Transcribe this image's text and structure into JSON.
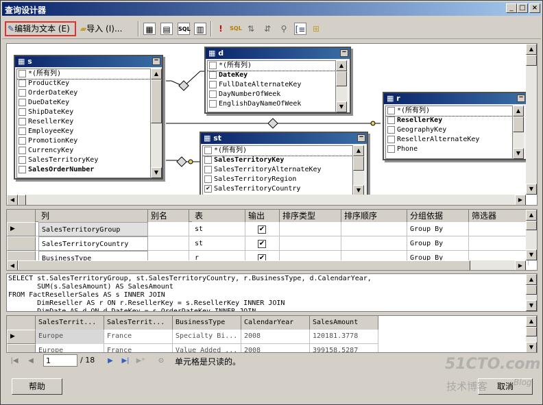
{
  "window": {
    "title": "查询设计器",
    "minimize_label": "_",
    "maximize_label": "□",
    "close_label": "×"
  },
  "toolbar": {
    "edit_as_text": "编辑为文本 (E)",
    "import": "导入 (I)..."
  },
  "diagram": {
    "tables": [
      {
        "name": "s",
        "columns": [
          {
            "label": "*(所有列)",
            "bold": false,
            "checked": false
          },
          {
            "label": "ProductKey",
            "bold": false,
            "checked": false
          },
          {
            "label": "OrderDateKey",
            "bold": false,
            "checked": false
          },
          {
            "label": "DueDateKey",
            "bold": false,
            "checked": false
          },
          {
            "label": "ShipDateKey",
            "bold": false,
            "checked": false
          },
          {
            "label": "ResellerKey",
            "bold": false,
            "checked": false
          },
          {
            "label": "EmployeeKey",
            "bold": false,
            "checked": false
          },
          {
            "label": "PromotionKey",
            "bold": false,
            "checked": false
          },
          {
            "label": "CurrencyKey",
            "bold": false,
            "checked": false
          },
          {
            "label": "SalesTerritoryKey",
            "bold": false,
            "checked": false
          },
          {
            "label": "SalesOrderNumber",
            "bold": true,
            "checked": false
          }
        ]
      },
      {
        "name": "d",
        "columns": [
          {
            "label": "*(所有列)",
            "bold": false,
            "checked": false
          },
          {
            "label": "DateKey",
            "bold": true,
            "checked": false
          },
          {
            "label": "FullDateAlternateKey",
            "bold": false,
            "checked": false
          },
          {
            "label": "DayNumberOfWeek",
            "bold": false,
            "checked": false
          },
          {
            "label": "EnglishDayNameOfWeek",
            "bold": false,
            "checked": false
          }
        ]
      },
      {
        "name": "r",
        "columns": [
          {
            "label": "*(所有列)",
            "bold": false,
            "checked": false
          },
          {
            "label": "ResellerKey",
            "bold": true,
            "checked": false
          },
          {
            "label": "GeographyKey",
            "bold": false,
            "checked": false
          },
          {
            "label": "ResellerAlternateKey",
            "bold": false,
            "checked": false
          },
          {
            "label": "Phone",
            "bold": false,
            "checked": false
          }
        ]
      },
      {
        "name": "st",
        "columns": [
          {
            "label": "*(所有列)",
            "bold": false,
            "checked": false
          },
          {
            "label": "SalesTerritoryKey",
            "bold": true,
            "checked": false
          },
          {
            "label": "SalesTerritoryAlternateKey",
            "bold": false,
            "checked": false
          },
          {
            "label": "SalesTerritoryRegion",
            "bold": false,
            "checked": false
          },
          {
            "label": "SalesTerritoryCountry",
            "bold": false,
            "checked": true
          }
        ]
      }
    ]
  },
  "criteria": {
    "headers": [
      "列",
      "别名",
      "表",
      "输出",
      "排序类型",
      "排序顺序",
      "分组依据",
      "筛选器"
    ],
    "rows": [
      {
        "column": "SalesTerritoryGroup",
        "alias": "",
        "table": "st",
        "output": "✔",
        "group": "Group By"
      },
      {
        "column": "SalesTerritoryCountry",
        "alias": "",
        "table": "st",
        "output": "✔",
        "group": "Group By"
      },
      {
        "column": "BusinessType",
        "alias": "",
        "table": "r",
        "output": "✔",
        "group": "Group By"
      }
    ]
  },
  "sql": {
    "lines": [
      "SELECT st.SalesTerritoryGroup, st.SalesTerritoryCountry, r.BusinessType, d.CalendarYear,",
      "       SUM(s.SalesAmount) AS SalesAmount",
      "FROM FactResellerSales AS s INNER JOIN",
      "       DimReseller AS r ON r.ResellerKey = s.ResellerKey INNER JOIN",
      "       DimDate AS d ON d.DateKey = s.OrderDateKey INNER JOIN"
    ]
  },
  "results": {
    "headers": [
      "SalesTerrit...",
      "SalesTerrit...",
      "BusinessType",
      "CalendarYear",
      "SalesAmount"
    ],
    "rows": [
      [
        "Europe",
        "France",
        "Specialty Bi...",
        "2008",
        "120181.3778"
      ],
      [
        "Europe",
        "France",
        "Value Added ...",
        "2008",
        "399158.5287"
      ]
    ]
  },
  "navigator": {
    "current_page": "1",
    "of_label": "/ 18",
    "status": "单元格是只读的。"
  },
  "footer": {
    "help": "帮助",
    "cancel": "取消"
  },
  "watermark": {
    "line1": "51CTO.com",
    "line2": "技术博客",
    "line3": "Blog"
  }
}
